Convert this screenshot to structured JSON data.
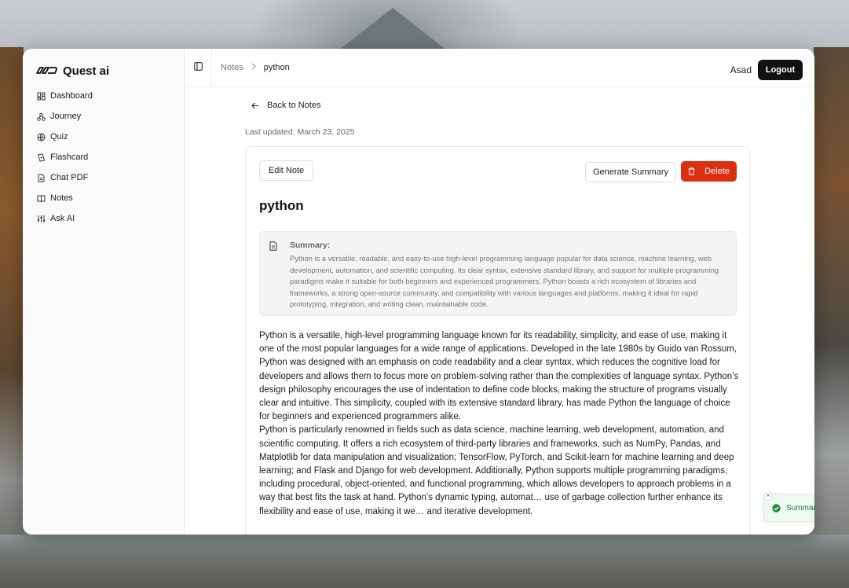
{
  "brand": {
    "name": "Quest ai"
  },
  "sidebar": {
    "items": [
      {
        "label": "Dashboard",
        "icon": "dashboard-icon"
      },
      {
        "label": "Journey",
        "icon": "journey-icon"
      },
      {
        "label": "Quiz",
        "icon": "quiz-icon"
      },
      {
        "label": "Flashcard",
        "icon": "flashcard-icon"
      },
      {
        "label": "Chat PDF",
        "icon": "pdf-icon"
      },
      {
        "label": "Notes",
        "icon": "notes-icon"
      },
      {
        "label": "Ask AI",
        "icon": "ask-ai-icon"
      }
    ]
  },
  "header": {
    "breadcrumb": {
      "parent": "Notes",
      "current": "python"
    },
    "username": "Asad",
    "logout_label": "Logout"
  },
  "note": {
    "back_label": "Back to Notes",
    "last_updated": "Last updated: March 23, 2025",
    "edit_label": "Edit Note",
    "generate_label": "Generate Summary",
    "delete_label": "Delete",
    "title": "python",
    "summary_label": "Summary:",
    "summary_text": "Python is a versatile, readable, and easy-to-use high-level programming language popular for data science, machine learning, web development, automation, and scientific computing. Its clear syntax, extensive standard library, and support for multiple programming paradigms make it suitable for both beginners and experienced programmers. Python boasts a rich ecosystem of libraries and frameworks, a strong open-source community, and compatibility with various languages and platforms, making it ideal for rapid prototyping, integration, and writing clean, maintainable code.",
    "paragraphs": [
      "Python is a versatile, high-level programming language known for its readability, simplicity, and ease of use, making it one of the most popular languages for a wide range of applications. Developed in the late 1980s by Guido van Rossum, Python was designed with an emphasis on code readability and a clear syntax, which reduces the cognitive load for developers and allows them to focus more on problem-solving rather than the complexities of language syntax. Python’s design philosophy encourages the use of indentation to define code blocks, making the structure of programs visually clear and intuitive. This simplicity, coupled with its extensive standard library, has made Python the language of choice for beginners and experienced programmers alike.",
      "Python is particularly renowned in fields such as data science, machine learning, web development, automation, and scientific computing. It offers a rich ecosystem of third-party libraries and frameworks, such as NumPy, Pandas, and Matplotlib for data manipulation and visualization; TensorFlow, PyTorch, and Scikit-learn for machine learning and deep learning; and Flask and Django for web development. Additionally, Python supports multiple programming paradigms, including procedural, object-oriented, and functional programming, which allows developers to approach problems in a way that best fits the task at hand. Python’s dynamic typing, automat… use of garbage collection further enhance its flexibility and ease of use, making it we… and iterative development."
    ]
  },
  "toast": {
    "message": "Summary generated successfully",
    "close": "×"
  },
  "colors": {
    "delete": "#dc2f12",
    "toast_bg": "#eefaf1",
    "toast_text": "#1f7a3a",
    "dark": "#111111"
  }
}
